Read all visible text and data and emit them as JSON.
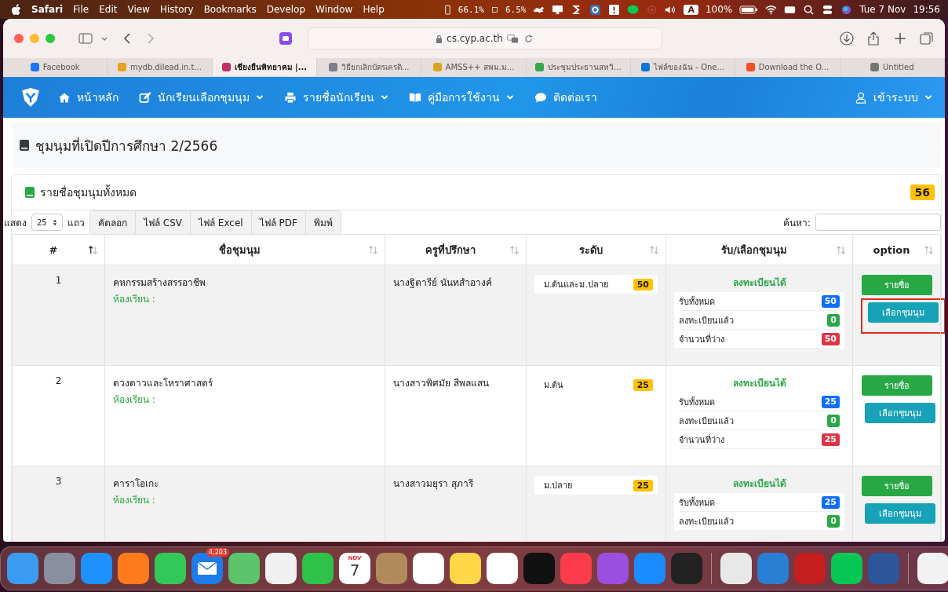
{
  "menubar": {
    "app": "Safari",
    "menus": [
      "File",
      "Edit",
      "View",
      "History",
      "Bookmarks",
      "Develop",
      "Window",
      "Help"
    ],
    "cpu": "66.1%",
    "memory": "6.5%",
    "input_source": "A",
    "battery": "100%",
    "date": "Tue 7 Nov",
    "time": "19:56"
  },
  "browser": {
    "address": "cs.cyp.ac.th",
    "tabs": [
      {
        "label": "Facebook",
        "selected": false,
        "color": "#1877f2"
      },
      {
        "label": "mydb.dilead.in.t...",
        "selected": false,
        "color": "#e8a020"
      },
      {
        "label": "เชียงยืนพิทยาคม |...",
        "selected": true,
        "color": "#c0306a"
      },
      {
        "label": "วิธียกเลิกบัตรเครดิ...",
        "selected": false,
        "color": "#7a7f8a"
      },
      {
        "label": "AMSS++ สพม.ม...",
        "selected": false,
        "color": "#d9a520"
      },
      {
        "label": "ประชุมประธานสหวิ...",
        "selected": false,
        "color": "#34a853"
      },
      {
        "label": "ไฟล์ของฉัน - One...",
        "selected": false,
        "color": "#0a78d4"
      },
      {
        "label": "Download the O...",
        "selected": false,
        "color": "#f25022"
      },
      {
        "label": "Untitled",
        "selected": false,
        "color": "#777777"
      }
    ]
  },
  "nav": {
    "items": [
      {
        "kind": "home",
        "label": "หน้าหลัก",
        "dropdown": false
      },
      {
        "kind": "edit",
        "label": "นักเรียนเลือกชุมนุม",
        "dropdown": true
      },
      {
        "kind": "print",
        "label": "รายชื่อนักเรียน",
        "dropdown": true
      },
      {
        "kind": "book",
        "label": "คู่มือการใช้งาน",
        "dropdown": true
      },
      {
        "kind": "chat",
        "label": "ติดต่อเรา",
        "dropdown": false
      }
    ],
    "login": "เข้าระบบ"
  },
  "heading": "ชุมนุมที่เปิดปีการศึกษา 2/2566",
  "card": {
    "title": "รายชื่อชุมนุมทั้งหมด",
    "count": "56",
    "show_label": "แสดง",
    "page_size": "25",
    "rows_label": "แถว",
    "export_buttons": [
      "คัดลอก",
      "ไฟล์ CSV",
      "ไฟล์ Excel",
      "ไฟล์ PDF",
      "พิมพ์"
    ],
    "search_label": "ค้นหา:"
  },
  "table": {
    "columns": [
      {
        "label": "#",
        "sorted": true
      },
      {
        "label": "ชื่อชุมนุม",
        "sorted": false
      },
      {
        "label": "ครูที่ปรึกษา",
        "sorted": false
      },
      {
        "label": "ระดับ",
        "sorted": false
      },
      {
        "label": "รับ/เลือกชุมนุม",
        "sorted": false
      },
      {
        "label": "option",
        "sorted": false
      }
    ],
    "rows": [
      {
        "number": "1",
        "name": "คหกรรมสร้างสรรอาชีพ",
        "room_label": "ห้องเรียน :",
        "teacher": "นางฐิตารีย์ นันทสำอางค์",
        "level": "ม.ต้นและม.ปลาย",
        "capacity": "50",
        "status": "ลงทะเบียนได้",
        "stats": [
          {
            "kind": "total",
            "label": "รับทั้งหมด",
            "value": "50"
          },
          {
            "kind": "registered",
            "label": "ลงทะเบียนแล้ว",
            "value": "0"
          },
          {
            "kind": "available",
            "label": "จำนวนที่ว่าง",
            "value": "50"
          }
        ],
        "list_button": "รายชื่อ",
        "select_button": "เลือกชุมนุม",
        "highlighted": true
      },
      {
        "number": "2",
        "name": "ดวงดาวและโหราศาสตร์",
        "room_label": "ห้องเรียน :",
        "teacher": "นางสาวพิศมัย สีพลแสน",
        "level": "ม.ต้น",
        "capacity": "25",
        "status": "ลงทะเบียนได้",
        "stats": [
          {
            "kind": "total",
            "label": "รับทั้งหมด",
            "value": "25"
          },
          {
            "kind": "registered",
            "label": "ลงทะเบียนแล้ว",
            "value": "0"
          },
          {
            "kind": "available",
            "label": "จำนวนที่ว่าง",
            "value": "25"
          }
        ],
        "list_button": "รายชื่อ",
        "select_button": "เลือกชุมนุม",
        "highlighted": false
      },
      {
        "number": "3",
        "name": "คาราโอเกะ",
        "room_label": "ห้องเรียน :",
        "teacher": "นางสาวมยุรา สุภารี",
        "level": "ม.ปลาย",
        "capacity": "25",
        "status": "ลงทะเบียนได้",
        "stats": [
          {
            "kind": "total",
            "label": "รับทั้งหมด",
            "value": "25"
          },
          {
            "kind": "registered",
            "label": "ลงทะเบียนแล้ว",
            "value": "0"
          }
        ],
        "list_button": "รายชื่อ",
        "select_button": "เลือกชุมนุม",
        "highlighted": false
      }
    ]
  },
  "dock": {
    "mail_badge": "4,203",
    "calendar_month": "NOV",
    "calendar_day": "7"
  }
}
